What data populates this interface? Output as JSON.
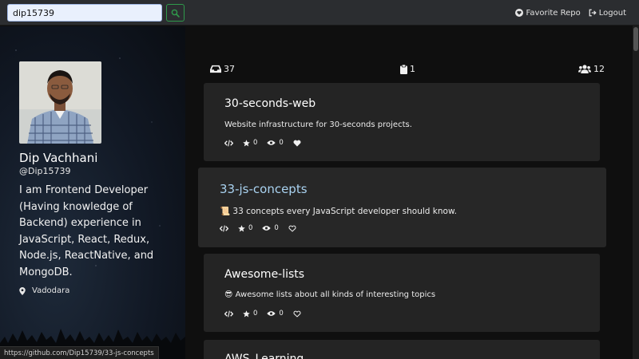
{
  "header": {
    "search_value": "dip15739",
    "favorite_label": "Favorite Repo",
    "logout_label": "Logout"
  },
  "profile": {
    "name": "Dip Vachhani",
    "handle": "@Dip15739",
    "bio": "I am Frontend Developer (Having knowledge of Backend) experience in JavaScript, React, Redux, Node.js, ReactNative, and MongoDB.",
    "location": "Vadodara"
  },
  "stats": {
    "repos": "37",
    "gists": "1",
    "followers": "12"
  },
  "repos": [
    {
      "title": "30-seconds-web",
      "description": "Website infrastructure for 30-seconds projects.",
      "stars": "0",
      "watchers": "0"
    },
    {
      "title": "33-js-concepts",
      "description": "📜 33 concepts every JavaScript developer should know.",
      "stars": "0",
      "watchers": "0"
    },
    {
      "title": "Awesome-lists",
      "description": "😎 Awesome lists about all kinds of interesting topics",
      "stars": "0",
      "watchers": "0"
    },
    {
      "title": "AWS_Learning"
    }
  ],
  "status_url": "https://github.com/Dip15739/33-js-concepts",
  "colors": {
    "accent_green": "#2f9a4b",
    "highlight_title": "#a9d2f0",
    "card_bg": "#242424"
  }
}
